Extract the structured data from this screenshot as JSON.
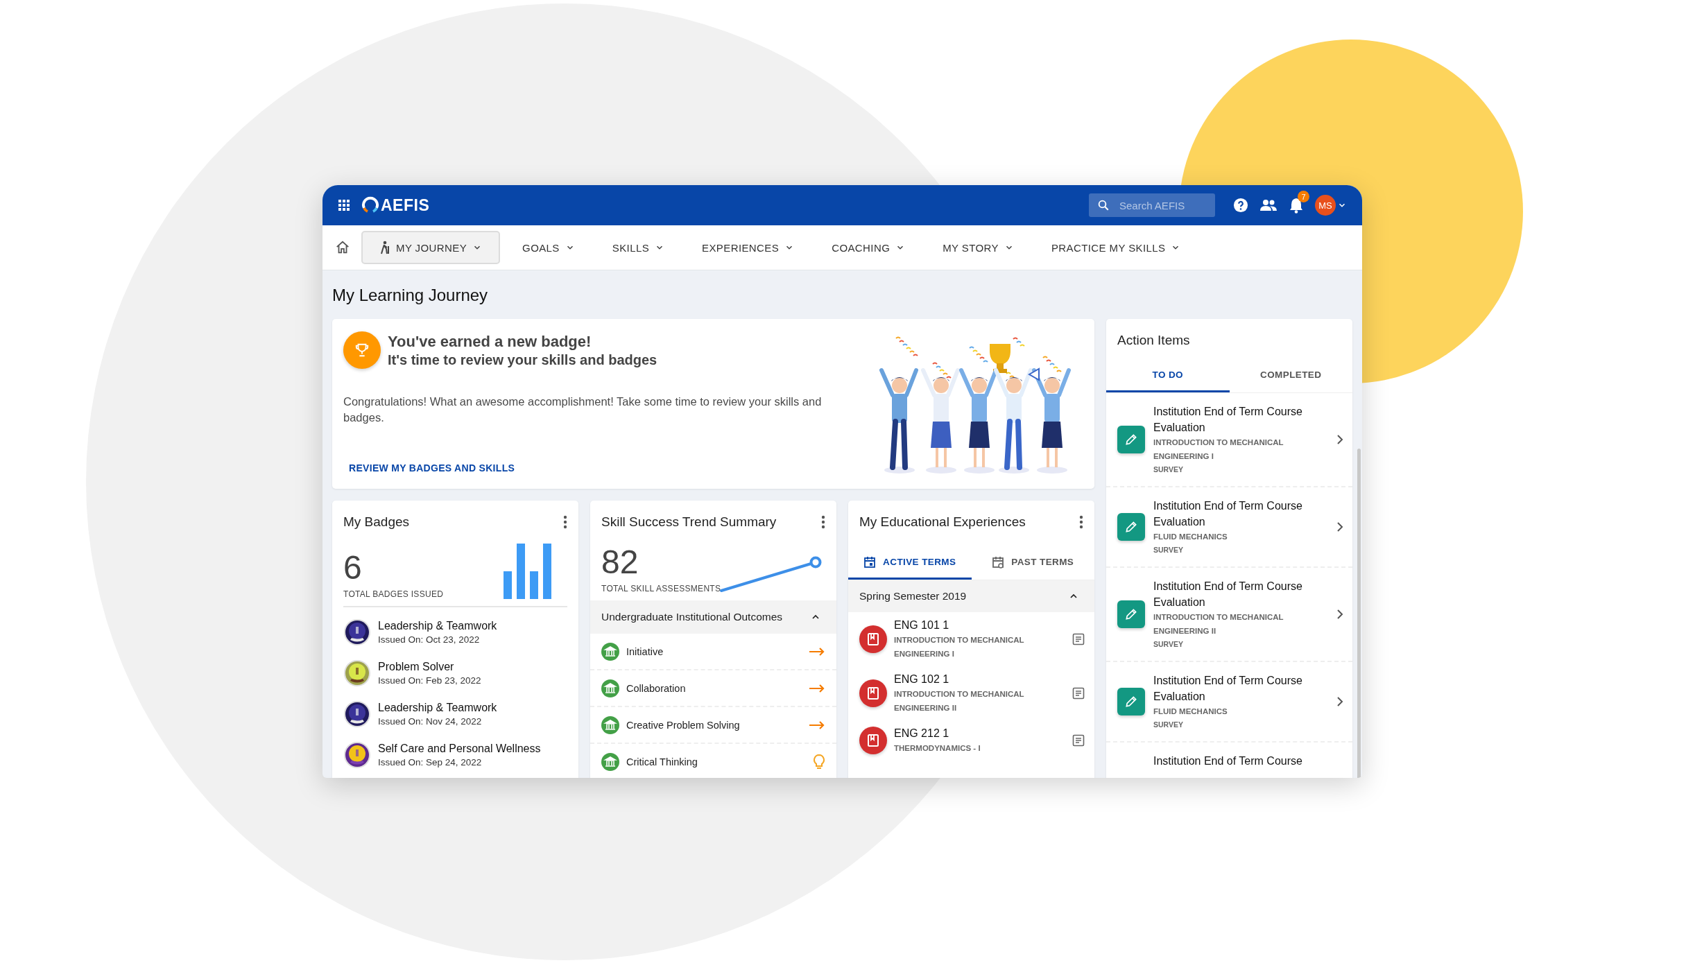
{
  "header": {
    "app_name": "AEFIS",
    "search": {
      "placeholder": "Search AEFIS"
    },
    "notification_count": "7",
    "user_initials": "MS"
  },
  "nav": [
    {
      "label": "MY JOURNEY",
      "selected": true
    },
    {
      "label": "GOALS",
      "selected": false
    },
    {
      "label": "SKILLS",
      "selected": false
    },
    {
      "label": "EXPERIENCES",
      "selected": false
    },
    {
      "label": "COACHING",
      "selected": false
    },
    {
      "label": "MY STORY",
      "selected": false
    },
    {
      "label": "PRACTICE MY SKILLS",
      "selected": false
    }
  ],
  "page_title": "My Learning Journey",
  "banner": {
    "title": "You've earned a new badge!",
    "subtitle": "It's time to review your skills and badges",
    "message": "Congratulations! What an awesome accomplishment! Take some time to review your skills and badges.",
    "link": "REVIEW MY BADGES AND SKILLS"
  },
  "badges_card": {
    "title": "My Badges",
    "total": "6",
    "total_label": "TOTAL BADGES ISSUED",
    "badges": [
      {
        "name": "Leadership & Teamwork",
        "issued": "Issued On: Oct 23, 2022",
        "kind": "leadership"
      },
      {
        "name": "Problem Solver",
        "issued": "Issued On: Feb 23, 2022",
        "kind": "solver"
      },
      {
        "name": "Leadership & Teamwork",
        "issued": "Issued On: Nov 24, 2022",
        "kind": "leadership"
      },
      {
        "name": "Self Care and Personal Wellness",
        "issued": "Issued On: Sep 24, 2022",
        "kind": "wellness"
      }
    ]
  },
  "skills_card": {
    "title": "Skill Success Trend Summary",
    "total": "82",
    "total_label": "TOTAL SKILL ASSESSMENTS",
    "group": {
      "label": "Undergraduate Institutional Outcomes",
      "expanded": true
    },
    "outcomes": [
      {
        "name": "Initiative",
        "kind": "arrow"
      },
      {
        "name": "Collaboration",
        "kind": "arrow"
      },
      {
        "name": "Creative Problem Solving",
        "kind": "arrow"
      },
      {
        "name": "Critical Thinking",
        "kind": "bulb"
      }
    ]
  },
  "experiences_card": {
    "title": "My Educational Experiences",
    "tabs": [
      {
        "label": "ACTIVE TERMS",
        "selected": true
      },
      {
        "label": "PAST TERMS",
        "selected": false
      }
    ],
    "term": {
      "label": "Spring Semester 2019",
      "expanded": true
    },
    "courses": [
      {
        "code": "ENG 101 1",
        "title": "INTRODUCTION TO MECHANICAL ENGINEERING I"
      },
      {
        "code": "ENG 102 1",
        "title": "INTRODUCTION TO MECHANICAL ENGINEERING II"
      },
      {
        "code": "ENG 212 1",
        "title": "THERMODYNAMICS - I"
      }
    ]
  },
  "action_items": {
    "title": "Action Items",
    "tabs": [
      {
        "label": "TO DO",
        "selected": true
      },
      {
        "label": "COMPLETED",
        "selected": false
      }
    ],
    "items": [
      {
        "title": "Institution End of Term Course Evaluation",
        "course": "INTRODUCTION TO MECHANICAL ENGINEERING I",
        "type": "SURVEY"
      },
      {
        "title": "Institution End of Term Course Evaluation",
        "course": "FLUID MECHANICS",
        "type": "SURVEY"
      },
      {
        "title": "Institution End of Term Course Evaluation",
        "course": "INTRODUCTION TO MECHANICAL ENGINEERING II",
        "type": "SURVEY"
      },
      {
        "title": "Institution End of Term Course Evaluation",
        "course": "FLUID MECHANICS",
        "type": "SURVEY"
      },
      {
        "title": "Institution End of Term Course"
      }
    ]
  }
}
